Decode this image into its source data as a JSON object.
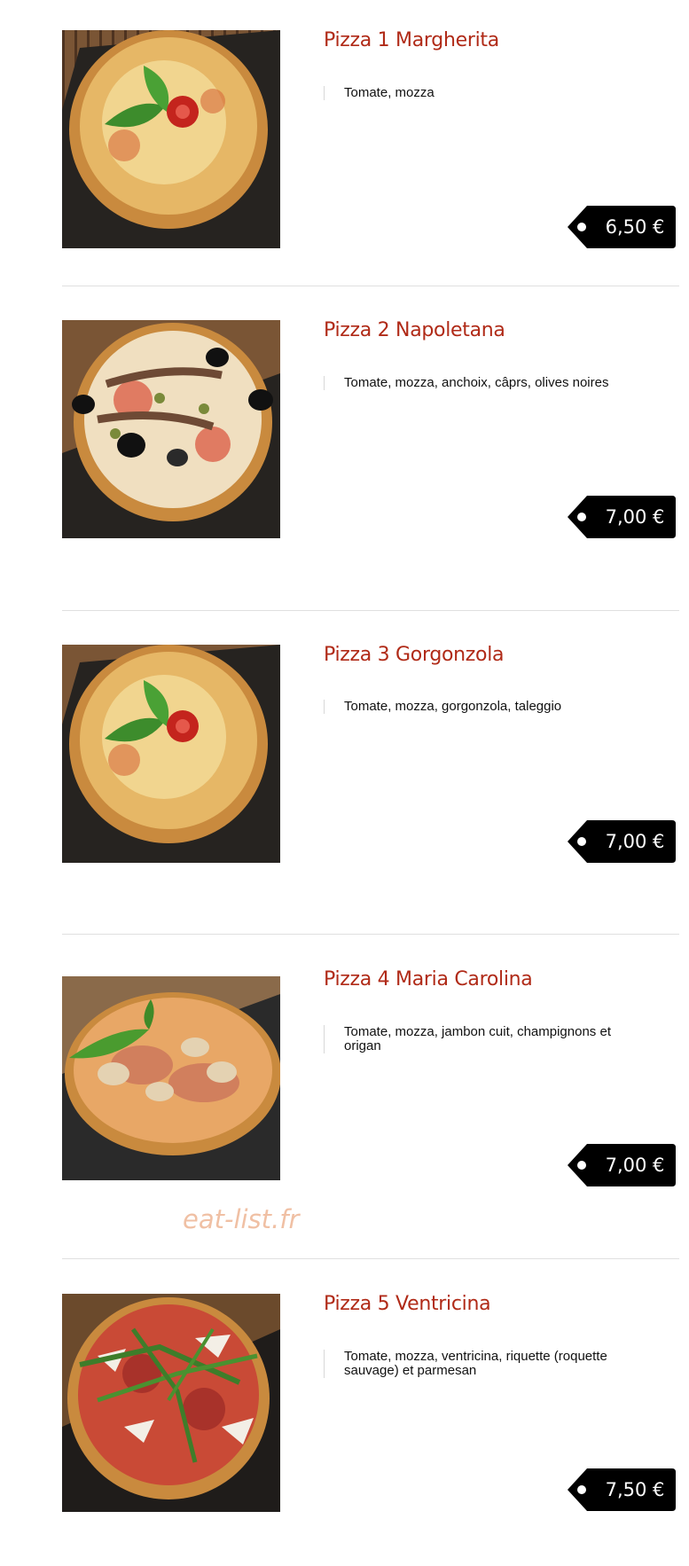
{
  "watermark": "eat-list.fr",
  "colors": {
    "title": "#b02a17",
    "price_tag": "#000000",
    "watermark": "#f0c0a4"
  },
  "menu": [
    {
      "title": "Pizza 1 Margherita",
      "description": "Tomate, mozza",
      "price": "6,50 €",
      "image": "margherita-pizza-photo"
    },
    {
      "title": "Pizza 2 Napoletana",
      "description": "Tomate, mozza, anchoix, câprs, olives noires",
      "price": "7,00 €",
      "image": "napoletana-pizza-photo"
    },
    {
      "title": "Pizza 3 Gorgonzola",
      "description": "Tomate, mozza, gorgonzola, taleggio",
      "price": "7,00 €",
      "image": "gorgonzola-pizza-photo"
    },
    {
      "title": "Pizza 4 Maria Carolina",
      "description": "Tomate, mozza, jambon cuit, champignons et origan",
      "price": "7,00 €",
      "image": "maria-carolina-pizza-photo"
    },
    {
      "title": "Pizza 5 Ventricina",
      "description": "Tomate, mozza, ventricina, riquette (roquette sauvage) et parmesan",
      "price": "7,50 €",
      "image": "ventricina-pizza-photo"
    }
  ]
}
